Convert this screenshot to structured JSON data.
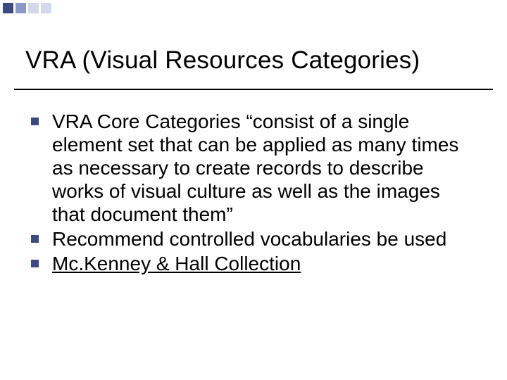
{
  "slide": {
    "title": "VRA (Visual Resources Categories)",
    "bullets": [
      {
        "text": "VRA Core Categories “consist of a single element set that can be applied as many times as necessary to create records to describe works of visual culture as well as the images that document them”",
        "link": false
      },
      {
        "text": "Recommend controlled vocabularies be used",
        "link": false
      },
      {
        "text": "Mc.Kenney & Hall Collection",
        "link": true
      }
    ]
  }
}
